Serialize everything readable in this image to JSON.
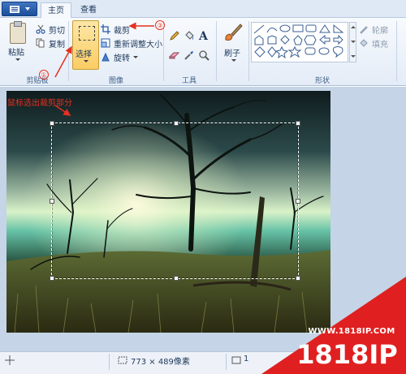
{
  "tabs": {
    "home": "主页",
    "view": "查看"
  },
  "clipboard": {
    "paste": "粘贴",
    "cut": "剪切",
    "copy": "复制",
    "group_label": "剪贴板"
  },
  "image": {
    "select": "选择",
    "crop": "裁剪",
    "resize": "重新调整大小",
    "rotate": "旋转",
    "group_label": "图像"
  },
  "tools": {
    "group_label": "工具"
  },
  "brushes": {
    "label": "刷子"
  },
  "shapes": {
    "outline": "轮廓",
    "fill": "填充",
    "group_label": "形状"
  },
  "annotations": {
    "instruction": "鼠标选出裁剪部分",
    "step1": "①",
    "step3": "③",
    "color": "#e53022"
  },
  "statusbar": {
    "selection_size": "773 × 489像素",
    "extra": "1"
  },
  "watermark": {
    "site": "WWW.1818IP.COM",
    "brand": "1818IP",
    "color": "#e02020"
  },
  "colors": {
    "ribbon": "#e4ecf7",
    "selected_tool": "#fbcc63",
    "canvas_bg": "#c5d4e7"
  }
}
